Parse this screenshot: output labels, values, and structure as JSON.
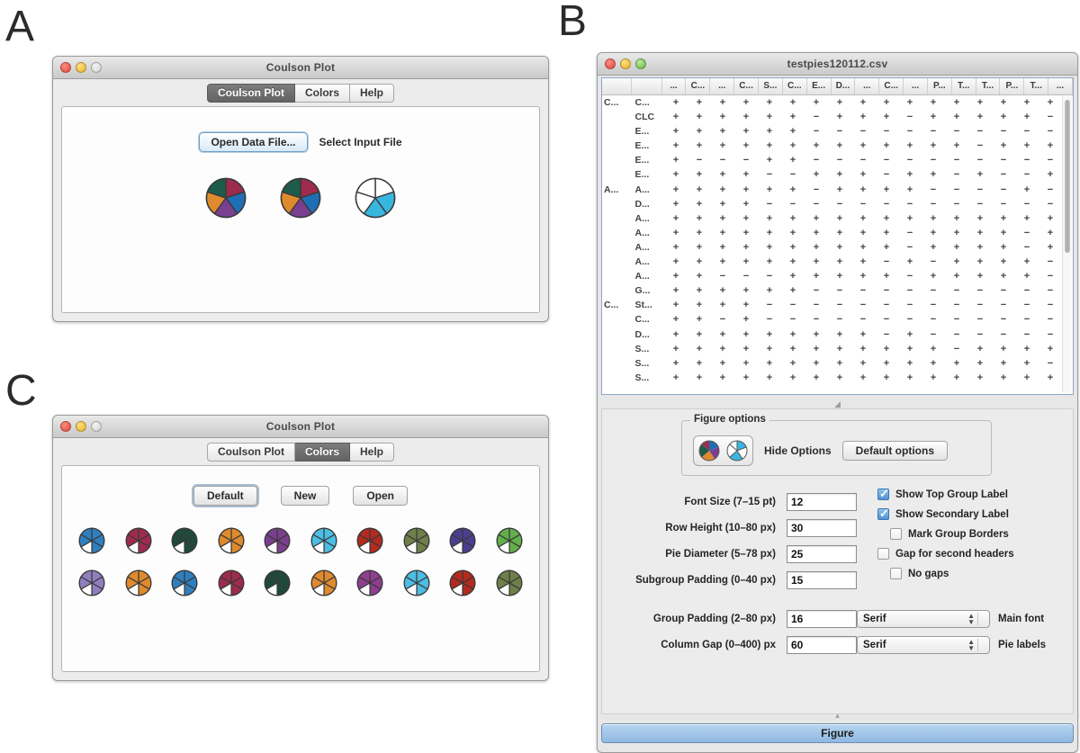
{
  "panels": {
    "a": "A",
    "b": "B",
    "c": "C"
  },
  "window_a": {
    "title": "Coulson Plot",
    "tabs": [
      {
        "label": "Coulson Plot",
        "active": true
      },
      {
        "label": "Colors",
        "active": false
      },
      {
        "label": "Help",
        "active": false
      }
    ],
    "open_button": "Open Data File...",
    "hint": "Select Input File",
    "pies": [
      {
        "name": "pie-sample-1",
        "slices": [
          "#9e2b4e",
          "#1f6fb5",
          "#7b3f8f",
          "#e08a2e",
          "#1d5c4a"
        ]
      },
      {
        "name": "pie-sample-2",
        "slices": [
          "#9e2b4e",
          "#1f6fb5",
          "#7b3f8f",
          "#e08a2e",
          "#1d5c4a"
        ]
      },
      {
        "name": "pie-sample-3",
        "slices": [
          "#ffffff",
          "#37b6e0",
          "#37b6e0",
          "#ffffff",
          "#ffffff"
        ]
      }
    ]
  },
  "window_c": {
    "title": "Coulson Plot",
    "tabs": [
      {
        "label": "Coulson Plot",
        "active": false
      },
      {
        "label": "Colors",
        "active": true
      },
      {
        "label": "Help",
        "active": false
      }
    ],
    "buttons": [
      {
        "label": "Default",
        "focused": true
      },
      {
        "label": "New",
        "focused": false
      },
      {
        "label": "Open",
        "focused": false
      }
    ],
    "swatch_rows": [
      [
        "#2f7fbf",
        "#9e2b4e",
        "#1d4a3a",
        "#e08a2e",
        "#7b3f8f",
        "#4cbde4",
        "#b32a1f",
        "#6f7f4a",
        "#4a3f8f",
        "#62b04a"
      ],
      [
        "#8f7fbf",
        "#e08a2e",
        "#2f7fbf",
        "#9e2b4e",
        "#1d4a3a",
        "#e08a2e",
        "#8f3f8f",
        "#4cbde4",
        "#b32a1f",
        "#6f7f4a"
      ]
    ]
  },
  "window_b": {
    "title": "testpies120112.csv",
    "table": {
      "headers": [
        "",
        "",
        "...",
        "C...",
        "...",
        "C...",
        "S...",
        "C...",
        "E...",
        "D...",
        "...",
        "C...",
        "...",
        "P...",
        "T...",
        "T...",
        "P...",
        "T...",
        "..."
      ],
      "rows": [
        {
          "group": "C...",
          "name": "C...",
          "cells": [
            "+",
            "+",
            "+",
            "+",
            "+",
            "+",
            "+",
            "+",
            "+",
            "+",
            "+",
            "+",
            "+",
            "+",
            "+",
            "+",
            "+"
          ]
        },
        {
          "group": "",
          "name": "CLC",
          "cells": [
            "+",
            "+",
            "+",
            "+",
            "+",
            "+",
            "−",
            "+",
            "+",
            "+",
            "−",
            "+",
            "+",
            "+",
            "+",
            "+",
            "−"
          ]
        },
        {
          "group": "",
          "name": "E...",
          "cells": [
            "+",
            "+",
            "+",
            "+",
            "+",
            "+",
            "−",
            "−",
            "−",
            "−",
            "−",
            "−",
            "−",
            "−",
            "−",
            "−",
            "−"
          ]
        },
        {
          "group": "",
          "name": "E...",
          "cells": [
            "+",
            "+",
            "+",
            "+",
            "+",
            "+",
            "+",
            "+",
            "+",
            "+",
            "+",
            "+",
            "+",
            "−",
            "+",
            "+",
            "+"
          ]
        },
        {
          "group": "",
          "name": "E...",
          "cells": [
            "+",
            "−",
            "−",
            "−",
            "+",
            "+",
            "−",
            "−",
            "−",
            "−",
            "−",
            "−",
            "−",
            "−",
            "−",
            "−",
            "−"
          ]
        },
        {
          "group": "",
          "name": "E...",
          "cells": [
            "+",
            "+",
            "+",
            "+",
            "−",
            "−",
            "+",
            "+",
            "+",
            "−",
            "+",
            "+",
            "−",
            "+",
            "−",
            "−",
            "+"
          ]
        },
        {
          "group": "A...",
          "name": "A...",
          "cells": [
            "+",
            "+",
            "+",
            "+",
            "+",
            "+",
            "−",
            "+",
            "+",
            "+",
            "+",
            "−",
            "−",
            "−",
            "−",
            "+",
            "−"
          ]
        },
        {
          "group": "",
          "name": "D...",
          "cells": [
            "+",
            "+",
            "+",
            "+",
            "−",
            "−",
            "−",
            "−",
            "−",
            "−",
            "−",
            "−",
            "−",
            "−",
            "−",
            "−",
            "−"
          ]
        },
        {
          "group": "",
          "name": "A...",
          "cells": [
            "+",
            "+",
            "+",
            "+",
            "+",
            "+",
            "+",
            "+",
            "+",
            "+",
            "+",
            "+",
            "+",
            "+",
            "+",
            "+",
            "+"
          ]
        },
        {
          "group": "",
          "name": "A...",
          "cells": [
            "+",
            "+",
            "+",
            "+",
            "+",
            "+",
            "+",
            "+",
            "+",
            "+",
            "−",
            "+",
            "+",
            "+",
            "+",
            "−",
            "+"
          ]
        },
        {
          "group": "",
          "name": "A...",
          "cells": [
            "+",
            "+",
            "+",
            "+",
            "+",
            "+",
            "+",
            "+",
            "+",
            "+",
            "−",
            "+",
            "+",
            "+",
            "+",
            "−",
            "+"
          ]
        },
        {
          "group": "",
          "name": "A...",
          "cells": [
            "+",
            "+",
            "+",
            "+",
            "+",
            "+",
            "+",
            "+",
            "+",
            "−",
            "+",
            "−",
            "+",
            "+",
            "+",
            "+",
            "−"
          ]
        },
        {
          "group": "",
          "name": "A...",
          "cells": [
            "+",
            "+",
            "−",
            "−",
            "−",
            "+",
            "+",
            "+",
            "+",
            "+",
            "−",
            "+",
            "+",
            "+",
            "+",
            "+",
            "−"
          ]
        },
        {
          "group": "",
          "name": "G...",
          "cells": [
            "+",
            "+",
            "+",
            "+",
            "+",
            "+",
            "−",
            "−",
            "−",
            "−",
            "−",
            "−",
            "−",
            "−",
            "−",
            "−",
            "−"
          ]
        },
        {
          "group": "C...",
          "name": "St...",
          "cells": [
            "+",
            "+",
            "+",
            "+",
            "−",
            "−",
            "−",
            "−",
            "−",
            "−",
            "−",
            "−",
            "−",
            "−",
            "−",
            "−",
            "−"
          ]
        },
        {
          "group": "",
          "name": "C...",
          "cells": [
            "+",
            "+",
            "−",
            "+",
            "−",
            "−",
            "−",
            "−",
            "−",
            "−",
            "−",
            "−",
            "−",
            "−",
            "−",
            "−",
            "−"
          ]
        },
        {
          "group": "",
          "name": "D...",
          "cells": [
            "+",
            "+",
            "+",
            "+",
            "+",
            "+",
            "+",
            "+",
            "+",
            "−",
            "+",
            "−",
            "−",
            "−",
            "−",
            "−",
            "−"
          ]
        },
        {
          "group": "",
          "name": "S...",
          "cells": [
            "+",
            "+",
            "+",
            "+",
            "+",
            "+",
            "+",
            "+",
            "+",
            "+",
            "+",
            "+",
            "−",
            "+",
            "+",
            "+",
            "+"
          ]
        },
        {
          "group": "",
          "name": "S...",
          "cells": [
            "+",
            "+",
            "+",
            "+",
            "+",
            "+",
            "+",
            "+",
            "+",
            "+",
            "+",
            "+",
            "+",
            "+",
            "+",
            "+",
            "−"
          ]
        },
        {
          "group": "",
          "name": "S...",
          "cells": [
            "+",
            "+",
            "+",
            "+",
            "+",
            "+",
            "+",
            "+",
            "+",
            "+",
            "+",
            "+",
            "+",
            "+",
            "+",
            "+",
            "+"
          ]
        }
      ]
    },
    "figure_options": {
      "legend": "Figure options",
      "hide_options_label": "Hide Options",
      "default_options_button": "Default options",
      "icon_pie_filled": "pie-color-icon",
      "icon_pie_partial": "pie-partial-icon"
    },
    "fields": [
      {
        "label": "Font Size (7–15 pt)",
        "value": "12",
        "name": "font-size"
      },
      {
        "label": "Row Height (10–80 px)",
        "value": "30",
        "name": "row-height"
      },
      {
        "label": "Pie Diameter (5–78 px)",
        "value": "25",
        "name": "pie-diameter"
      },
      {
        "label": "Subgroup Padding (0–40 px)",
        "value": "15",
        "name": "subgroup-padding"
      },
      {
        "label": "Group Padding (2–80 px)",
        "value": "16",
        "name": "group-padding",
        "select": "Serif",
        "after": "Main font"
      },
      {
        "label": "Column Gap (0–400) px",
        "value": "60",
        "name": "column-gap",
        "select": "Serif",
        "after": "Pie labels"
      }
    ],
    "checkboxes": [
      {
        "label": "Show Top Group Label",
        "checked": true,
        "indent": false
      },
      {
        "label": "Show Secondary Label",
        "checked": true,
        "indent": false
      },
      {
        "label": "Mark Group Borders",
        "checked": false,
        "indent": true
      },
      {
        "label": "Gap for second headers",
        "checked": false,
        "indent": false
      },
      {
        "label": "No gaps",
        "checked": false,
        "indent": true
      }
    ],
    "figure_button": "Figure"
  }
}
